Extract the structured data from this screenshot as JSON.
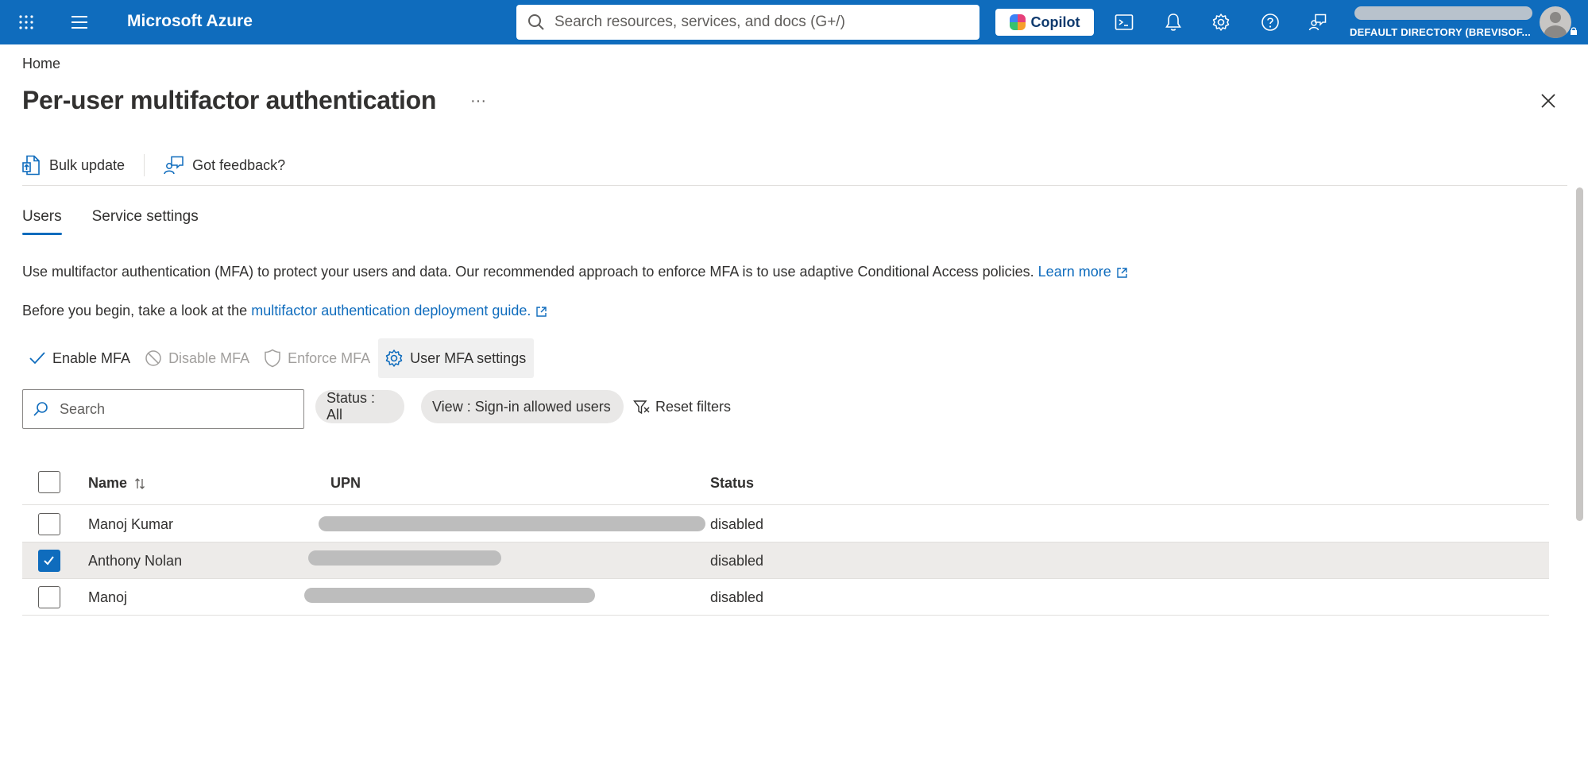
{
  "topbar": {
    "brand": "Microsoft Azure",
    "search_placeholder": "Search resources, services, and docs (G+/)",
    "copilot_label": "Copilot",
    "directory": "DEFAULT DIRECTORY (BREVISOF..."
  },
  "page": {
    "breadcrumb": "Home",
    "title": "Per-user multifactor authentication",
    "more": "···"
  },
  "commands": {
    "bulk_update": "Bulk update",
    "feedback": "Got feedback?"
  },
  "tabs": [
    {
      "label": "Users",
      "active": true
    },
    {
      "label": "Service settings",
      "active": false
    }
  ],
  "info": {
    "intro": "Use multifactor authentication (MFA) to protect your users and data. Our recommended approach to enforce MFA is to use adaptive Conditional Access policies.",
    "learn_more": "Learn more",
    "before": "Before you begin, take a look at the",
    "guide_link": "multifactor authentication deployment guide."
  },
  "actions": {
    "enable": "Enable MFA",
    "disable": "Disable MFA",
    "enforce": "Enforce MFA",
    "settings": "User MFA settings"
  },
  "filters": {
    "search_placeholder": "Search",
    "status": "Status : All",
    "view": "View : Sign-in allowed users",
    "reset": "Reset filters"
  },
  "table": {
    "columns": {
      "name": "Name",
      "upn": "UPN",
      "status": "Status"
    },
    "rows": [
      {
        "name": "Manoj Kumar",
        "status": "disabled",
        "selected": false
      },
      {
        "name": "Anthony Nolan",
        "status": "disabled",
        "selected": true
      },
      {
        "name": "Manoj",
        "status": "disabled",
        "selected": false
      }
    ]
  },
  "colors": {
    "azure_blue": "#0f6cbd",
    "text": "#323130",
    "selected_row": "#edebe9"
  }
}
